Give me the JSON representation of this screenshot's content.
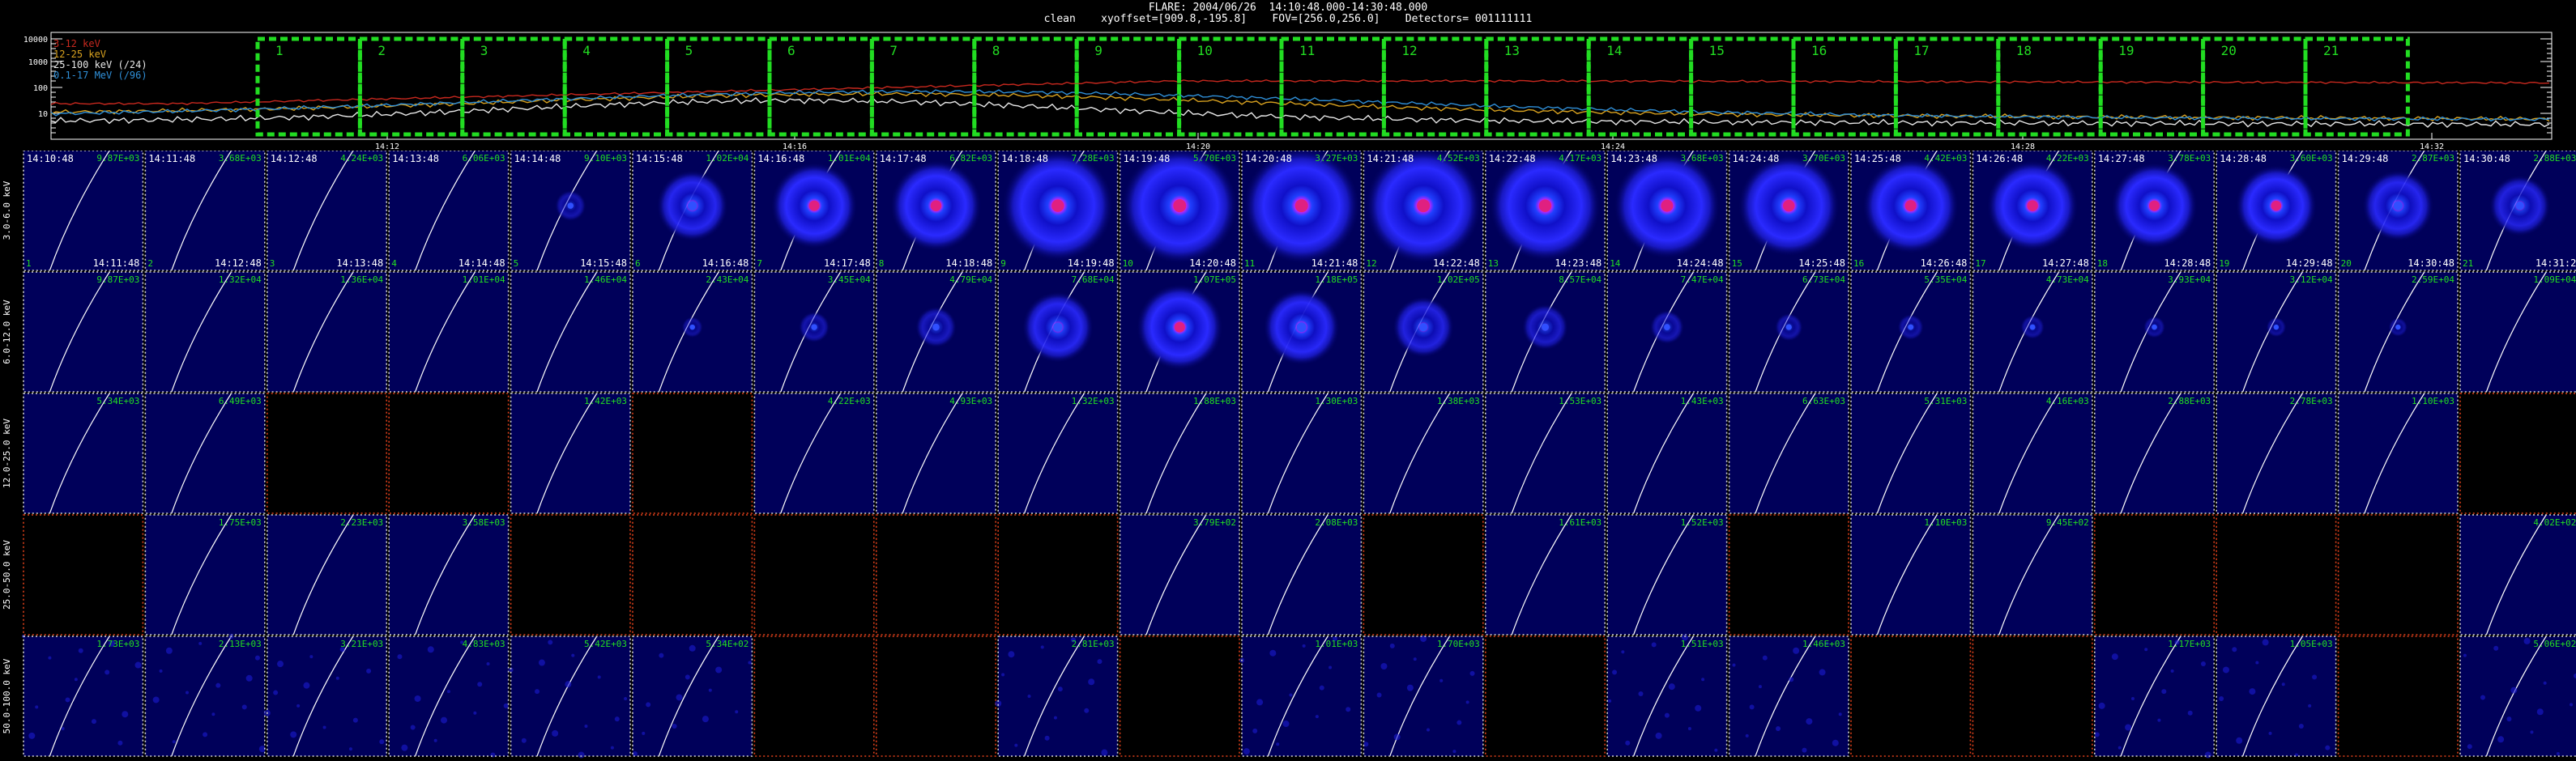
{
  "header": {
    "line1": "FLARE: 2004/06/26  14:10:48.000-14:30:48.000",
    "line2": "clean    xyoffset=[909.8,-195.8]    FOV=[256.0,256.0]    Detectors= 001111111"
  },
  "lightcurve": {
    "yticks": [
      "10000",
      "1000",
      "100",
      "10"
    ],
    "xticks": [
      "14:12",
      "14:16",
      "14:20",
      "14:24",
      "14:28",
      "14:32"
    ],
    "legend": [
      {
        "label": "3-12 keV",
        "color": "#c8281e"
      },
      {
        "label": "12-25 keV",
        "color": "#d9a21f"
      },
      {
        "label": "25-100 keV (/24)",
        "color": "#e8e8e8"
      },
      {
        "label": "0.1-17 MeV (/96)",
        "color": "#2f8fd8"
      }
    ],
    "intervals": [
      "1",
      "2",
      "3",
      "4",
      "5",
      "6",
      "7",
      "8",
      "9",
      "10",
      "11",
      "12",
      "13",
      "14",
      "15",
      "16",
      "17",
      "18",
      "19",
      "20",
      "21"
    ],
    "interval_color": "#22dd22"
  },
  "grid": {
    "energy_bands": [
      "3.0-6.0 keV",
      "6.0-12.0 keV",
      "12.0-25.0 keV",
      "25.0-50.0 keV",
      "50.0-100.0 keV"
    ],
    "start_times": [
      "14:10:48",
      "14:11:48",
      "14:12:48",
      "14:13:48",
      "14:14:48",
      "14:15:48",
      "14:16:48",
      "14:17:48",
      "14:18:48",
      "14:19:48",
      "14:20:48",
      "14:21:48",
      "14:22:48",
      "14:23:48",
      "14:24:48",
      "14:25:48",
      "14:26:48",
      "14:27:48",
      "14:28:48",
      "14:29:48",
      "14:30:48"
    ],
    "end_times": [
      "14:11:48",
      "14:12:48",
      "14:13:48",
      "14:14:48",
      "14:15:48",
      "14:16:48",
      "14:17:48",
      "14:18:48",
      "14:19:48",
      "14:20:48",
      "14:21:48",
      "14:22:48",
      "14:23:48",
      "14:24:48",
      "14:25:48",
      "14:26:48",
      "14:27:48",
      "14:28:48",
      "14:29:48",
      "14:30:48",
      "14:31:2"
    ],
    "peaks": [
      [
        "9.87E+03",
        "3.68E+03",
        "4.24E+03",
        "6.06E+03",
        "9.10E+03",
        "1.02E+04",
        "1.01E+04",
        "6.82E+03",
        "7.28E+03",
        "5.70E+03",
        "3.27E+03",
        "4.52E+03",
        "4.17E+03",
        "3.68E+03",
        "3.70E+03",
        "4.42E+03",
        "4.22E+03",
        "3.78E+03",
        "3.60E+03",
        "2.87E+03",
        "2.88E+03"
      ],
      [
        "9.87E+03",
        "1.32E+04",
        "1.36E+04",
        "1.01E+04",
        "1.46E+04",
        "2.43E+04",
        "3.45E+04",
        "4.79E+04",
        "7.68E+04",
        "1.07E+05",
        "1.18E+05",
        "1.02E+05",
        "8.57E+04",
        "7.47E+04",
        "6.73E+04",
        "5.35E+04",
        "4.73E+04",
        "3.93E+04",
        "3.12E+04",
        "2.59E+04",
        "1.09E+04"
      ],
      [
        "5.34E+03",
        "6.49E+03",
        "",
        "",
        "1.42E+03",
        "",
        "4.22E+03",
        "4.93E+03",
        "1.32E+03",
        "1.88E+03",
        "1.30E+03",
        "1.38E+03",
        "1.53E+03",
        "1.43E+03",
        "6.63E+03",
        "5.31E+03",
        "4.16E+03",
        "2.88E+03",
        "2.78E+03",
        "1.10E+03",
        ""
      ],
      [
        "",
        "1.75E+03",
        "2.23E+03",
        "3.58E+03",
        "",
        "",
        "",
        "",
        "",
        "3.79E+02",
        "2.08E+03",
        "",
        "1.61E+03",
        "1.52E+03",
        "",
        "1.10E+03",
        "9.45E+02",
        "",
        "",
        "",
        "4.02E+02"
      ],
      [
        "1.73E+03",
        "2.13E+03",
        "3.21E+03",
        "4.83E+03",
        "5.42E+03",
        "5.34E+02",
        "",
        "",
        "2.81E+03",
        "",
        "1.01E+03",
        "1.70E+03",
        "",
        "1.51E+03",
        "1.46E+03",
        "",
        "",
        "1.17E+03",
        "1.05E+03",
        "",
        "5.06E+02"
      ]
    ],
    "empty": [
      [
        0,
        0,
        0,
        0,
        0,
        0,
        0,
        0,
        0,
        0,
        0,
        0,
        0,
        0,
        0,
        0,
        0,
        0,
        0,
        0,
        0
      ],
      [
        0,
        0,
        0,
        0,
        0,
        0,
        0,
        0,
        0,
        0,
        0,
        0,
        0,
        0,
        0,
        0,
        0,
        0,
        0,
        0,
        0
      ],
      [
        0,
        0,
        1,
        1,
        0,
        1,
        0,
        0,
        0,
        0,
        0,
        0,
        0,
        0,
        0,
        0,
        0,
        0,
        0,
        0,
        1
      ],
      [
        1,
        0,
        0,
        0,
        1,
        1,
        1,
        1,
        1,
        0,
        0,
        1,
        0,
        0,
        1,
        0,
        0,
        1,
        1,
        1,
        0
      ],
      [
        0,
        0,
        0,
        0,
        0,
        0,
        1,
        1,
        0,
        1,
        0,
        0,
        1,
        0,
        0,
        1,
        1,
        0,
        0,
        1,
        0
      ]
    ],
    "flare_intensity": [
      [
        0,
        0,
        0,
        0,
        0.15,
        0.55,
        0.7,
        0.75,
        0.95,
        1,
        1,
        1,
        0.95,
        0.9,
        0.85,
        0.8,
        0.75,
        0.7,
        0.65,
        0.55,
        0.45
      ],
      [
        0,
        0,
        0,
        0,
        0,
        0.05,
        0.15,
        0.25,
        0.55,
        0.7,
        0.6,
        0.45,
        0.3,
        0.18,
        0.12,
        0.1,
        0.08,
        0.06,
        0.04,
        0.03,
        0
      ],
      [
        0,
        0,
        0,
        0,
        0,
        0,
        0,
        0,
        0,
        0,
        0,
        0,
        0,
        0,
        0,
        0,
        0,
        0,
        0,
        0,
        0
      ],
      [
        0,
        0,
        0,
        0,
        0,
        0,
        0,
        0,
        0,
        0,
        0,
        0,
        0,
        0,
        0,
        0,
        0,
        0,
        0,
        0,
        0
      ],
      [
        0,
        0,
        0,
        0,
        0,
        0,
        0,
        0,
        0,
        0,
        0,
        0,
        0,
        0,
        0,
        0,
        0,
        0,
        0,
        0,
        0
      ]
    ],
    "colors": {
      "label": "#22dd22",
      "frame_ok": "#d8d8d8",
      "frame_empty": "#e0401a",
      "bg": "#00005a",
      "limb": "#ffffff"
    }
  }
}
